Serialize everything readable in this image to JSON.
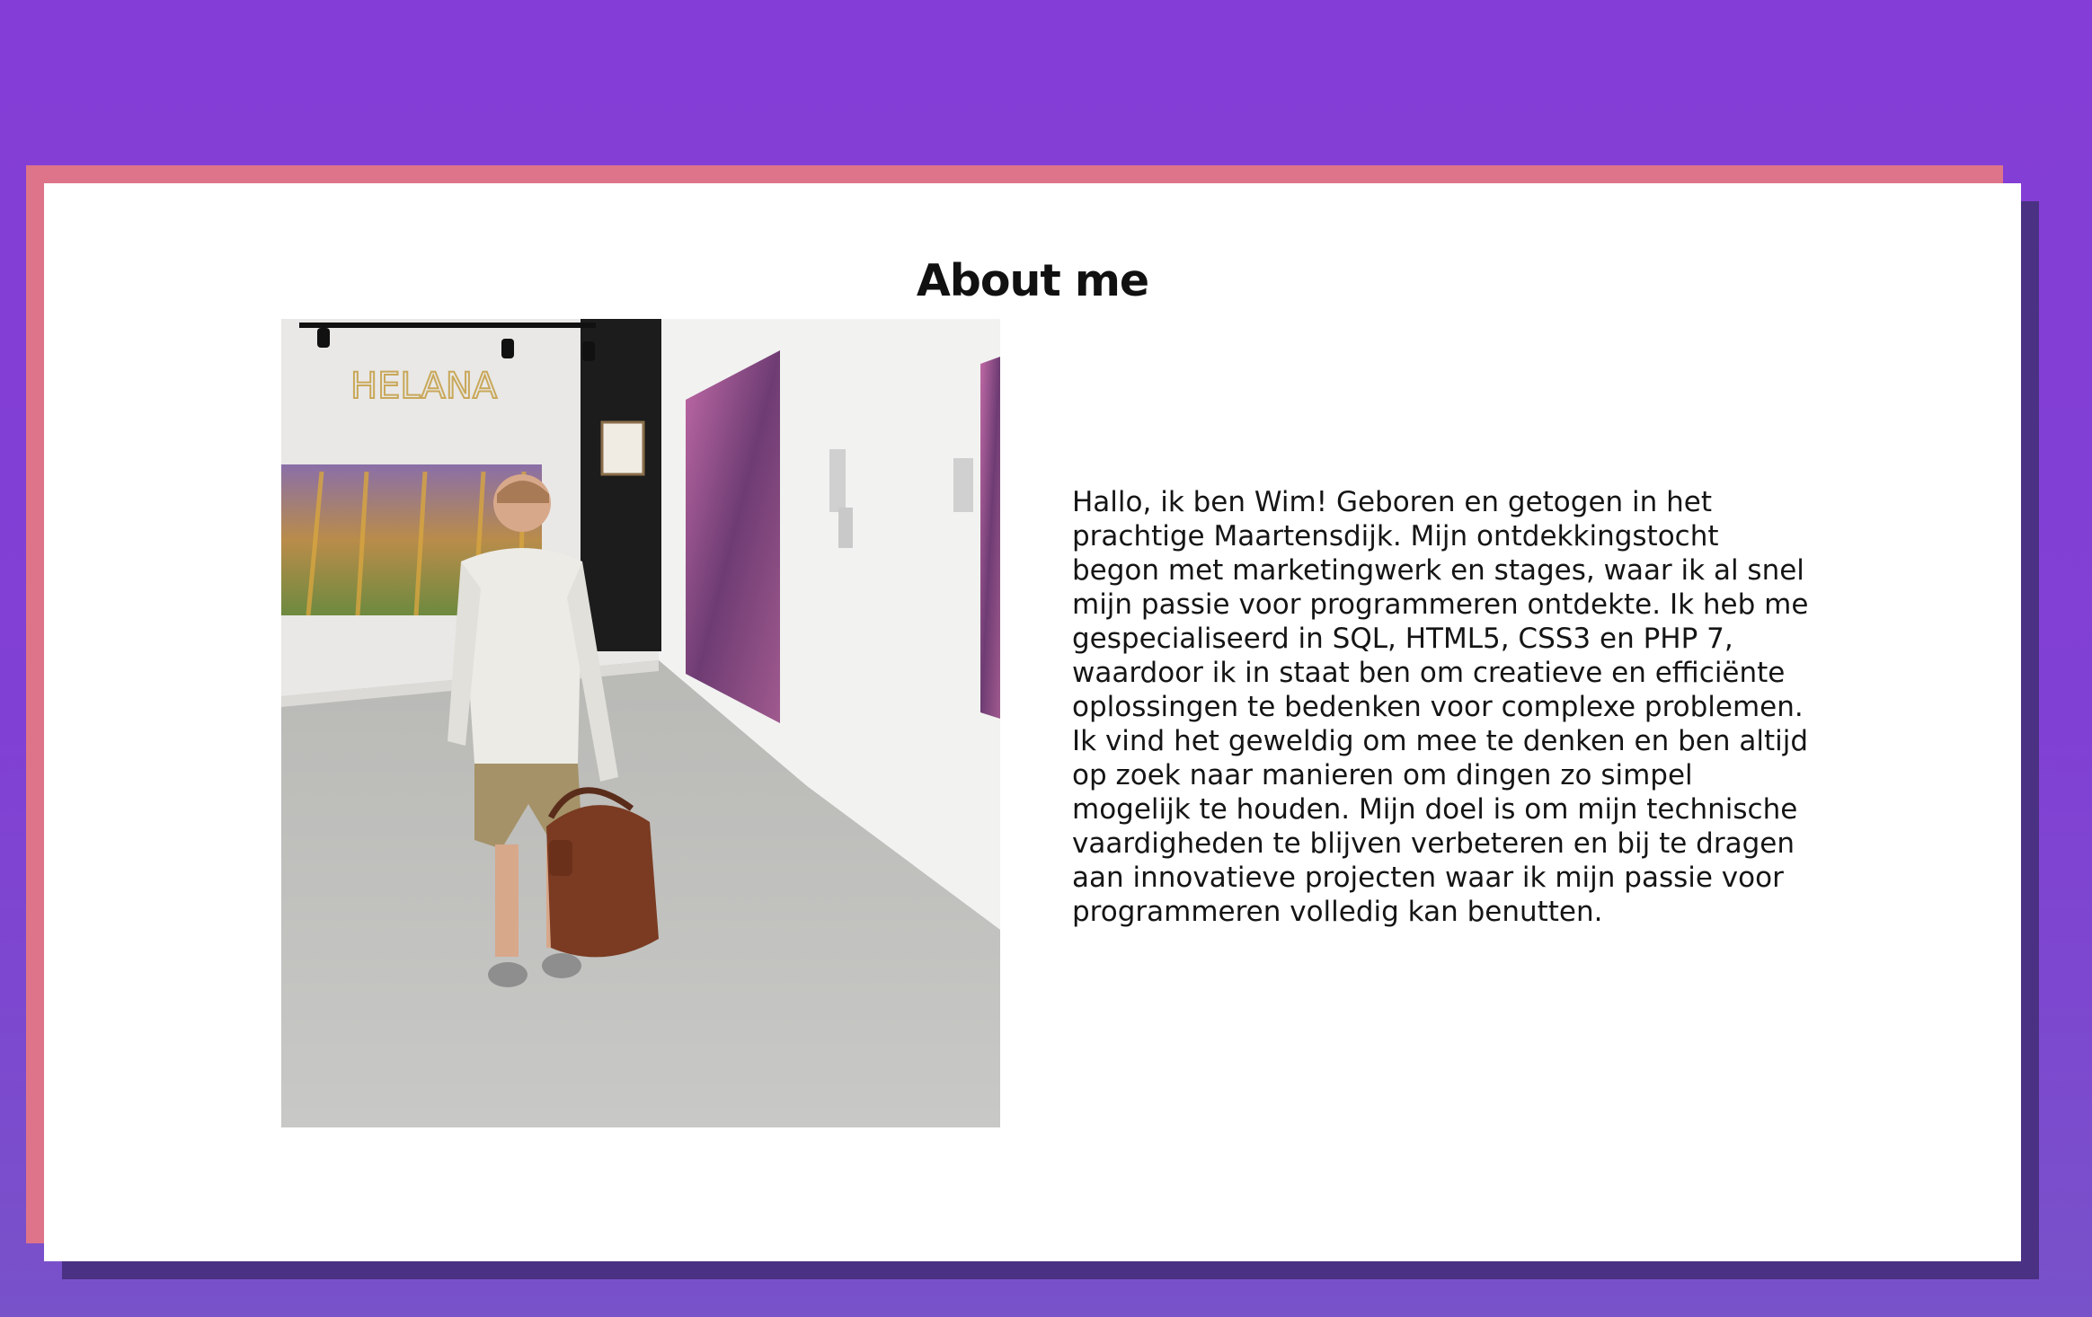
{
  "about": {
    "title": "About me",
    "photo": {
      "subject": "man-walking-in-gallery-photo",
      "sign_text": "HELANA"
    },
    "bio": "Hallo, ik ben Wim! Geboren en getogen in het prachtige Maartensdijk. Mijn ontdekkingstocht begon met marketingwerk en stages, waar ik al snel mijn passie voor programmeren ontdekte. Ik heb me gespecialiseerd in SQL, HTML5, CSS3 en PHP 7, waardoor ik in staat ben om creatieve en efficiënte oplossingen te bedenken voor complexe problemen. Ik vind het geweldig om mee te denken en ben altijd op zoek naar manieren om dingen zo simpel mogelijk te houden. Mijn doel is om mijn technische vaardigheden te blijven verbeteren en bij te dragen aan innovatieve projecten waar ik mijn passie voor programmeren volledig kan benutten."
  },
  "colors": {
    "background": "#843dd6",
    "accent_frame": "#dd7489",
    "shadow_frame": "#4a3183",
    "card": "#ffffff"
  }
}
